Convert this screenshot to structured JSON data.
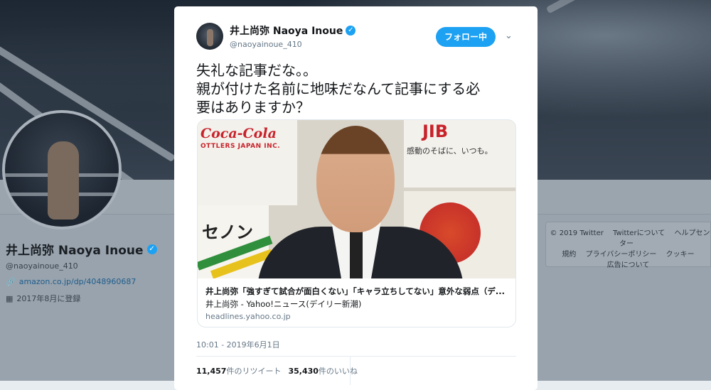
{
  "profile": {
    "name": "井上尚弥 Naoya Inoue",
    "handle": "@naoyainoue_410",
    "link": "amazon.co.jp/dp/4048960687",
    "joined": "2017年8月に登録"
  },
  "footer": {
    "links": [
      "© 2019 Twitter",
      "Twitterについて",
      "ヘルプセンター",
      "規約",
      "プライバシーポリシー",
      "クッキー",
      "広告について"
    ]
  },
  "tweet": {
    "author_name": "井上尚弥 Naoya Inoue",
    "author_handle": "@naoyainoue_410",
    "follow_label": "フォロー中",
    "text_lines": [
      "失礼な記事だな。。",
      "親が付けた名前に地味だなんて記事にする必",
      "要はありますか？"
    ],
    "card": {
      "title": "井上尚弥「強すぎて試合が面白くない」「キャラ立ちしてない」意外な弱点（デ...",
      "description": "井上尚弥 - Yahoo!ニュース(デイリー新潮)",
      "domain": "headlines.yahoo.co.jp",
      "photo_text": {
        "coke": "Coca-Cola",
        "bottlers": "OTTLERS JAPAN INC.",
        "jib": "JIB",
        "kando": "感動のそばに、いつも。",
        "senon": "セノン"
      }
    },
    "timestamp": "10:01 - 2019年6月1日",
    "retweets_count": "11,457",
    "retweets_label": "件のリツイート",
    "likes_count": "35,430",
    "likes_label": "件のいいね"
  },
  "colors": {
    "accent": "#1da1f2",
    "text": "#14171a",
    "muted": "#657786"
  },
  "icons": [
    "verified-icon",
    "chevron-down-icon",
    "link-icon",
    "calendar-icon"
  ]
}
